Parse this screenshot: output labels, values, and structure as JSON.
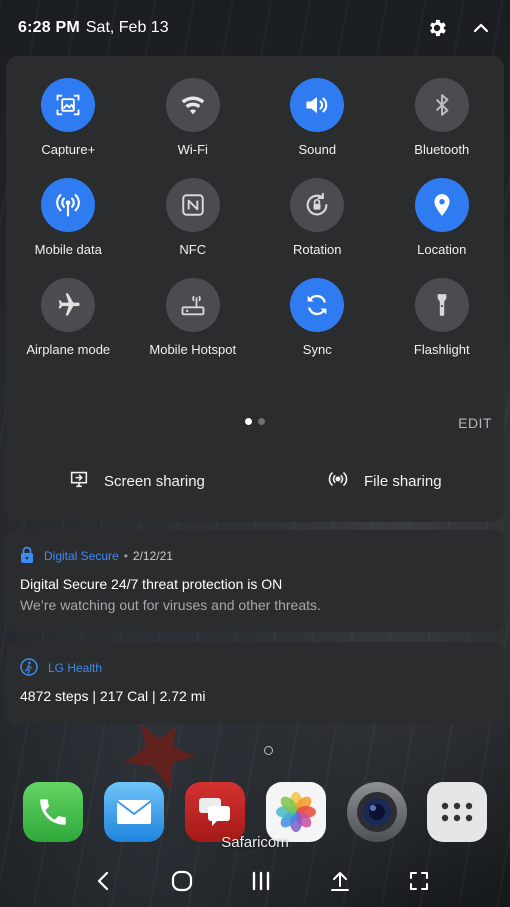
{
  "status_bar": {
    "time": "6:28 PM",
    "date": "Sat, Feb 13",
    "icons": [
      "gear-icon",
      "chevron-up-icon"
    ]
  },
  "quick_settings": {
    "tiles": [
      {
        "label": "Capture+",
        "icon": "capture-icon",
        "active": true
      },
      {
        "label": "Wi-Fi",
        "icon": "wifi-icon",
        "active": false
      },
      {
        "label": "Sound",
        "icon": "speaker-icon",
        "active": true
      },
      {
        "label": "Bluetooth",
        "icon": "bluetooth-icon",
        "active": false
      },
      {
        "label": "Mobile data",
        "icon": "antenna-icon",
        "active": true
      },
      {
        "label": "NFC",
        "icon": "nfc-icon",
        "active": false
      },
      {
        "label": "Rotation",
        "icon": "rotation-lock-icon",
        "active": false
      },
      {
        "label": "Location",
        "icon": "location-pin-icon",
        "active": true
      },
      {
        "label": "Airplane mode",
        "icon": "airplane-icon",
        "active": false
      },
      {
        "label": "Mobile Hotspot",
        "icon": "hotspot-icon",
        "active": false
      },
      {
        "label": "Sync",
        "icon": "sync-icon",
        "active": true
      },
      {
        "label": "Flashlight",
        "icon": "flashlight-icon",
        "active": false
      }
    ],
    "page_count": 2,
    "current_page": 1,
    "edit_label": "EDIT",
    "screen_sharing_label": "Screen sharing",
    "file_sharing_label": "File sharing"
  },
  "notifications": [
    {
      "app": "Digital Secure",
      "icon": "lock-icon",
      "time": "2/12/21",
      "title": "Digital Secure 24/7 threat protection is ON",
      "body": "We’re watching out for viruses and other threats."
    },
    {
      "app": "LG Health",
      "icon": "walking-person-icon",
      "title": "4872 steps | 217 Cal | 2.72 mi"
    }
  ],
  "home": {
    "carrier": "Safaricom",
    "dock_apps": [
      "phone-icon",
      "mail-icon",
      "messages-icon",
      "photos-icon",
      "camera-icon",
      "app-drawer-icon"
    ]
  },
  "nav_bar": [
    "back-icon",
    "home-icon",
    "recents-icon",
    "upload-icon",
    "fullscreen-icon"
  ],
  "colors": {
    "accent": "#2f7cf2",
    "panel": "#2b2c2e",
    "inactive_tile": "#4b4c4f",
    "notification_app": "#3f8bf4"
  }
}
